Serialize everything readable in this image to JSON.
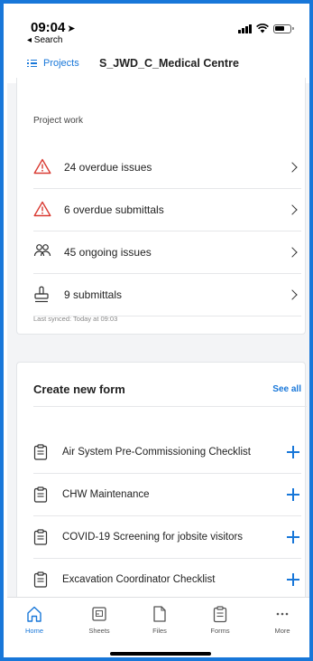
{
  "status_bar": {
    "time": "09:04",
    "location_arrow": "➤",
    "back_label": "◂ Search"
  },
  "nav": {
    "projects_label": "Projects",
    "title": "S_JWD_C_Medical Centre"
  },
  "project_work": {
    "heading": "Project work",
    "items": [
      {
        "label": "24 overdue issues",
        "icon": "warning-icon"
      },
      {
        "label": "6 overdue submittals",
        "icon": "warning-icon"
      },
      {
        "label": "45 ongoing issues",
        "icon": "people-icon"
      },
      {
        "label": "9 submittals",
        "icon": "stamp-icon"
      }
    ],
    "last_synced": "Last synced: Today at 09:03"
  },
  "create_form": {
    "title": "Create new form",
    "see_all": "See all",
    "items": [
      {
        "label": "Air System Pre-Commissioning Checklist"
      },
      {
        "label": "CHW Maintenance"
      },
      {
        "label": "COVID-19 Screening for jobsite visitors"
      },
      {
        "label": "Excavation Coordinator Checklist"
      }
    ]
  },
  "tabs": [
    {
      "label": "Home",
      "icon": "home-icon",
      "active": true
    },
    {
      "label": "Sheets",
      "icon": "sheets-icon",
      "active": false
    },
    {
      "label": "Files",
      "icon": "file-icon",
      "active": false
    },
    {
      "label": "Forms",
      "icon": "clipboard-icon",
      "active": false
    },
    {
      "label": "More",
      "icon": "more-icon",
      "active": false
    }
  ],
  "colors": {
    "accent": "#1877d9",
    "warning": "#d93a32",
    "background": "#f3f4f6"
  }
}
